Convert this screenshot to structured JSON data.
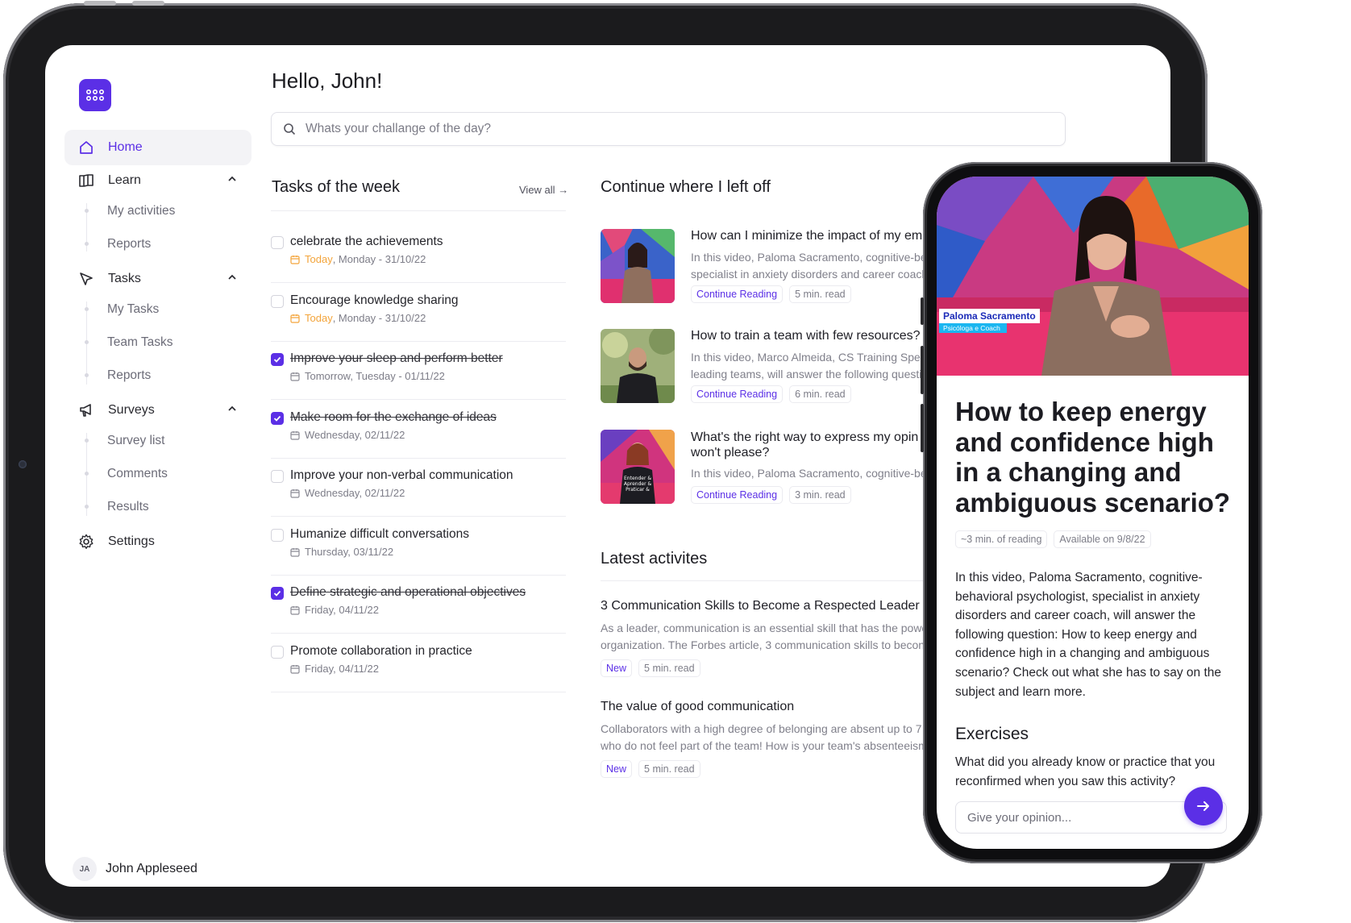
{
  "app": {
    "greeting": "Hello, John!",
    "search_placeholder": "Whats your challange of the day?",
    "accent_color": "#5b2fe6"
  },
  "sidebar": {
    "home": "Home",
    "learn": "Learn",
    "learn_items": [
      "My activities",
      "Reports"
    ],
    "tasks": "Tasks",
    "tasks_items": [
      "My Tasks",
      "Team Tasks",
      "Reports"
    ],
    "surveys": "Surveys",
    "surveys_items": [
      "Survey list",
      "Comments",
      "Results"
    ],
    "settings": "Settings",
    "user_initials": "JA",
    "user_name": "John Appleseed"
  },
  "tasks_section": {
    "title": "Tasks of the week",
    "view_all": "View all",
    "items": [
      {
        "title": "celebrate the achievements",
        "today": "Today",
        "date": ", Monday - 31/10/22",
        "done": false
      },
      {
        "title": "Encourage knowledge sharing",
        "today": "Today",
        "date": ", Monday - 31/10/22",
        "done": false
      },
      {
        "title": "Improve your sleep and perform better",
        "today": "",
        "date": "Tomorrow, Tuesday - 01/11/22",
        "done": true
      },
      {
        "title": "Make room for the exchange of ideas",
        "today": "",
        "date": "Wednesday, 02/11/22",
        "done": true
      },
      {
        "title": "Improve your non-verbal communication",
        "today": "",
        "date": "Wednesday, 02/11/22",
        "done": false
      },
      {
        "title": "Humanize difficult conversations",
        "today": "",
        "date": "Thursday, 03/11/22",
        "done": false
      },
      {
        "title": "Define strategic and operational objectives",
        "today": "",
        "date": "Friday, 04/11/22",
        "done": true
      },
      {
        "title": "Promote collaboration in practice",
        "today": "",
        "date": "Friday, 04/11/22",
        "done": false
      }
    ]
  },
  "continue_section": {
    "title": "Continue where I left off",
    "items": [
      {
        "title": "How can I minimize the impact of my em",
        "desc": "In this video, Paloma Sacramento, cognitive-be specialist in anxiety disorders and career coach",
        "action": "Continue Reading",
        "read": "5 min. read"
      },
      {
        "title": "How to train a team with few resources?",
        "desc": "In this video, Marco Almeida, CS Training Spec leading teams, will answer the following questi",
        "action": "Continue Reading",
        "read": "6 min. read"
      },
      {
        "title": "What's the right way to express my opin won't please?",
        "desc": "In this video, Paloma Sacramento, cognitive-be",
        "action": "Continue Reading",
        "read": "3 min. read"
      }
    ]
  },
  "latest_section": {
    "title": "Latest activites",
    "items": [
      {
        "title": "3 Communication Skills to Become a Respected Leader",
        "line1": "As a leader, communication is an essential skill that has the powe",
        "line2": "organization. The Forbes article, 3 communication skills to becon",
        "badge": "New",
        "read": "5 min. read"
      },
      {
        "title": "The value of good communication",
        "line1": "Collaborators with a high degree of belonging are absent up to 7",
        "line2": "who do not feel part of the team! How is your team's absenteeism",
        "badge": "New",
        "read": "5 min. read"
      }
    ]
  },
  "phone": {
    "presenter_name": "Paloma Sacramento",
    "presenter_role": "Psicóloga e Coach",
    "article_title": "How to keep energy and confidence high in a changing and ambiguous scenario?",
    "reading_time": "~3 min. of reading",
    "available": "Available on 9/8/22",
    "body": "In this video, Paloma Sacramento, cognitive-behavioral psychologist, specialist in anxiety disorders and career coach, will answer the following question: How to keep energy and confidence high in a changing and ambiguous scenario? Check out what she has to say on the subject and learn more.",
    "exercises_title": "Exercises",
    "exercise_question": "What did you already know or practice that you reconfirmed when you saw this activity?",
    "opinion_placeholder": "Give your opinion..."
  }
}
